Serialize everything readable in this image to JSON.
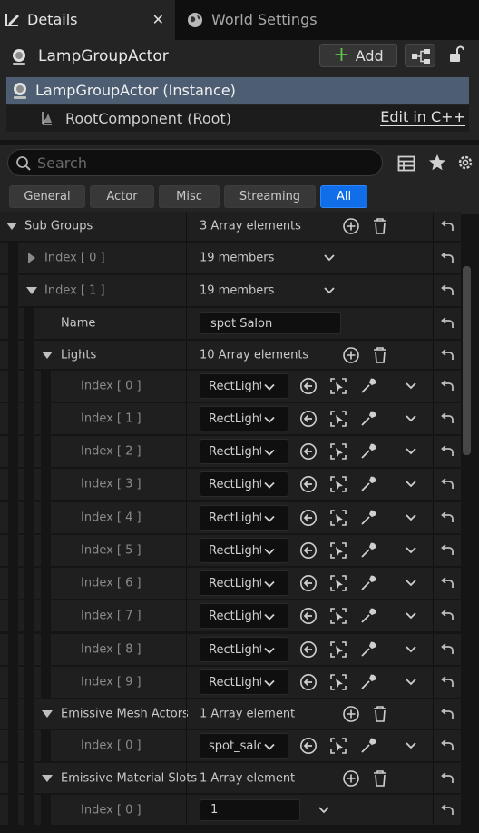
{
  "tabs": [
    {
      "label": "Details",
      "active": true
    },
    {
      "label": "World Settings",
      "active": false
    }
  ],
  "actor": {
    "name": "LampGroupActor",
    "add_label": "Add"
  },
  "components": {
    "selected": "LampGroupActor (Instance)",
    "root": "RootComponent (Root)",
    "edit_link": "Edit in C++"
  },
  "search": {
    "placeholder": "Search"
  },
  "filters": [
    "General",
    "Actor",
    "Misc",
    "Streaming",
    "All"
  ],
  "active_filter": "All",
  "rows": {
    "sub_groups": {
      "label": "Sub Groups",
      "value": "3 Array elements"
    },
    "idx0": {
      "label": "Index [ 0 ]",
      "value": "19 members"
    },
    "idx1": {
      "label": "Index [ 1 ]",
      "value": "19 members"
    },
    "name": {
      "label": "Name",
      "value": "spot Salon"
    },
    "lights": {
      "label": "Lights",
      "value": "10 Array elements"
    },
    "light_items": [
      {
        "label": "Index [ 0 ]",
        "value": "RectLight"
      },
      {
        "label": "Index [ 1 ]",
        "value": "RectLight"
      },
      {
        "label": "Index [ 2 ]",
        "value": "RectLight"
      },
      {
        "label": "Index [ 3 ]",
        "value": "RectLight"
      },
      {
        "label": "Index [ 4 ]",
        "value": "RectLight"
      },
      {
        "label": "Index [ 5 ]",
        "value": "RectLight"
      },
      {
        "label": "Index [ 6 ]",
        "value": "RectLight"
      },
      {
        "label": "Index [ 7 ]",
        "value": "RectLight"
      },
      {
        "label": "Index [ 8 ]",
        "value": "RectLight"
      },
      {
        "label": "Index [ 9 ]",
        "value": "RectLight"
      }
    ],
    "emissive_mesh": {
      "label": "Emissive Mesh Actors",
      "value": "1 Array element"
    },
    "emissive_mesh_item": {
      "label": "Index [ 0 ]",
      "value": "spot_salon"
    },
    "emissive_slots": {
      "label": "Emissive Material Slots",
      "value": "1 Array element"
    },
    "emissive_slots_item": {
      "label": "Index [ 0 ]",
      "value": "1"
    }
  },
  "colors": {
    "accent": "#0f6ee8",
    "selection": "#4d5e73",
    "add_plus": "#5fc24d"
  }
}
